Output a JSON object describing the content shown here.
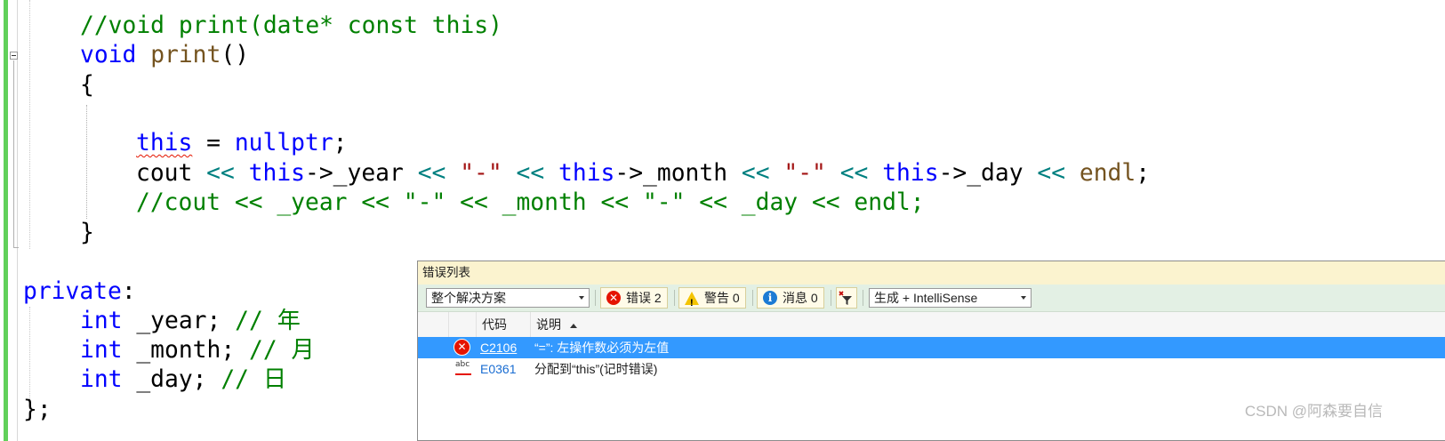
{
  "editor": {
    "lines": {
      "l1": "//void print(date* const this)",
      "l2_kw": "void",
      "l2_fn": "print",
      "l2_rest": "()",
      "l3": "{",
      "l5_this": "this",
      "l5_eq": " = ",
      "l5_null": "nullptr",
      "l5_semi": ";",
      "l6": {
        "cout": "cout ",
        "op1": "<<",
        "this1": " this",
        "year": "->_year ",
        "op2": "<<",
        "str1": " \"-\" ",
        "op3": "<<",
        "this2": " this",
        "month": "->_month ",
        "op4": "<<",
        "str2": " \"-\" ",
        "op5": "<<",
        "this3": " this",
        "day": "->_day ",
        "op6": "<<",
        "endl": " endl",
        "semi": ";"
      },
      "l7": "//cout << _year << \"-\" << _month << \"-\" << _day << endl;",
      "l8": "}",
      "l10_kw": "private",
      "l10_rest": ":",
      "l11_kw": "int",
      "l11_var": " _year; ",
      "l11_cm": "// 年",
      "l12_kw": "int",
      "l12_var": " _month; ",
      "l12_cm": "// 月",
      "l13_kw": "int",
      "l13_var": " _day; ",
      "l13_cm": "// 日",
      "l14": "};"
    }
  },
  "error_list": {
    "title": "错误列表",
    "scope_dropdown": "整个解决方案",
    "errors_button": "错误 2",
    "warnings_button": "警告 0",
    "messages_button": "消息 0",
    "build_dropdown": "生成 + IntelliSense",
    "columns": {
      "code": "代码",
      "description": "说明"
    },
    "rows": [
      {
        "icon": "error-icon",
        "code": "C2106",
        "description": "“=”: 左操作数必须为左值"
      },
      {
        "icon": "spelling-abc-icon",
        "code": "E0361",
        "description": "分配到“this”(记时错误)"
      }
    ]
  },
  "watermark": "CSDN @阿森要自信",
  "colors": {
    "keyword": "#0000ff",
    "comment": "#008000",
    "function": "#74531f",
    "string": "#a31515",
    "operator": "#008080",
    "selection": "#3399ff",
    "error": "#e51400"
  }
}
